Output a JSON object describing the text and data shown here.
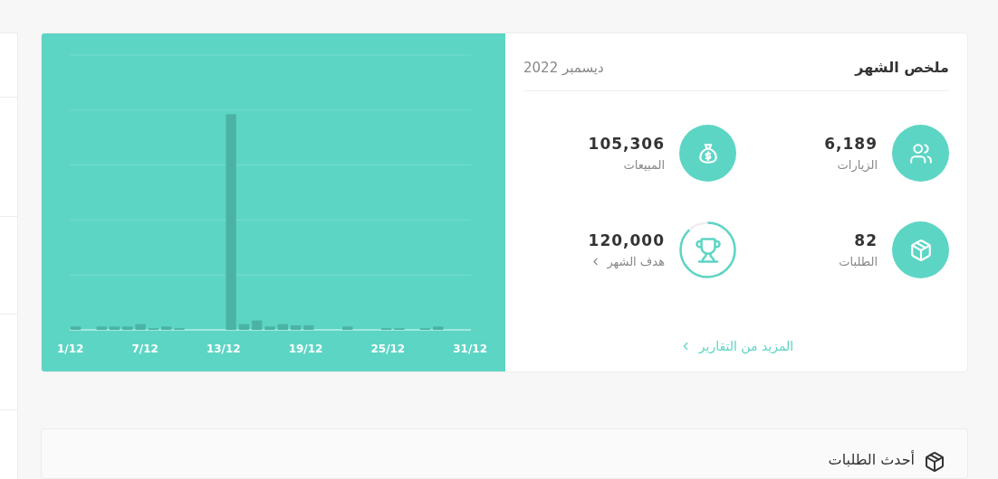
{
  "summary": {
    "title": "ملخص الشهر",
    "period": "ديسمبر 2022",
    "stats": [
      {
        "kind": "filled",
        "value": "6,189",
        "label": "الزيارات"
      },
      {
        "kind": "filled",
        "value": "105,306",
        "label": "المبيعات"
      },
      {
        "kind": "filled",
        "value": "82",
        "label": "الطلبات"
      },
      {
        "kind": "goal",
        "value": "120,000",
        "label": "هدف الشهر"
      }
    ],
    "more_link": "المزيد من التقارير"
  },
  "chart": {
    "axis_labels": [
      "31/12",
      "25/12",
      "19/12",
      "13/12",
      "7/12",
      "1/12"
    ]
  },
  "latest_orders": {
    "title": "أحدث الطلبات"
  }
}
